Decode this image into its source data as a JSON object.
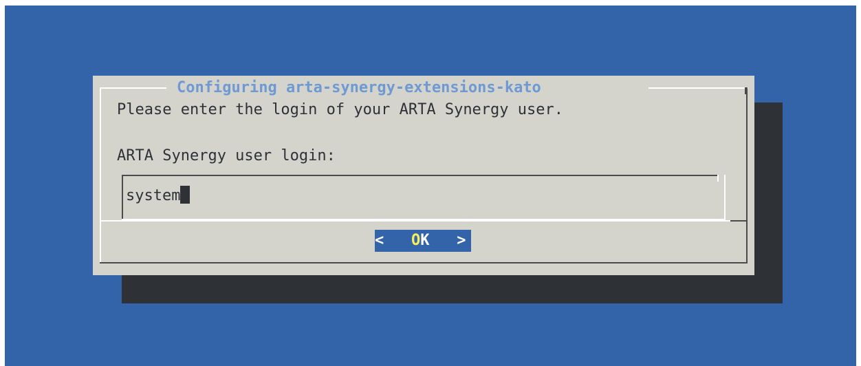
{
  "dialog": {
    "title": "Configuring arta-synergy-extensions-kato",
    "prompt": "Please enter the login of your ARTA Synergy user.",
    "field_label": "ARTA Synergy user login:",
    "input_value": "system"
  },
  "ok_button": {
    "left": "< ",
    "hotkey": "O",
    "rest": "K",
    "right": " >"
  },
  "colors": {
    "screen_background": "#3363a8",
    "dialog_background": "#d4d4cd",
    "title": "#6e99d2",
    "button_background": "#3363a8",
    "hotkey": "#f7ee5a"
  }
}
